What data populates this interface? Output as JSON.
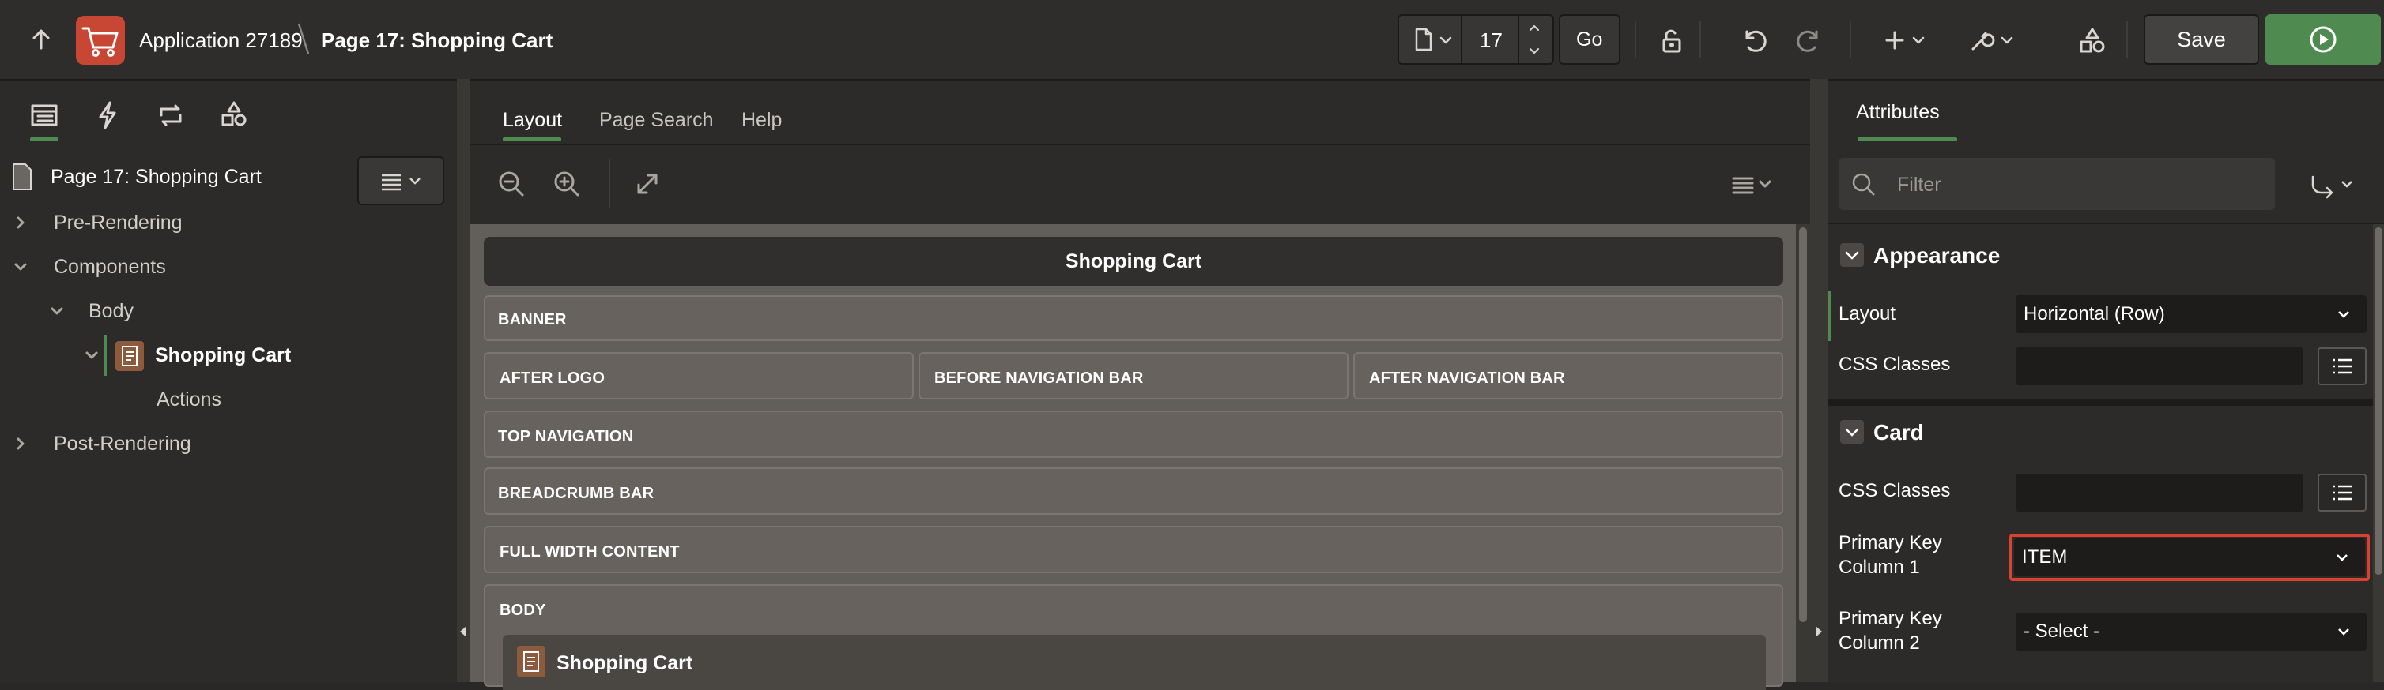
{
  "topbar": {
    "app_name": "Application 27189",
    "separator": "\\",
    "page_title": "Page 17: Shopping Cart",
    "page_number": "17",
    "go_label": "Go",
    "save_label": "Save",
    "colors": {
      "logo": "#c74634",
      "run": "#4f8b51"
    }
  },
  "left": {
    "root": "Page 17: Shopping Cart",
    "items": [
      {
        "label": "Pre-Rendering"
      },
      {
        "label": "Components"
      },
      {
        "label": "Body"
      },
      {
        "label": "Shopping Cart"
      },
      {
        "label": "Actions"
      },
      {
        "label": "Post-Rendering"
      }
    ]
  },
  "center": {
    "tabs": [
      "Layout",
      "Page Search",
      "Help"
    ],
    "page_header": "Shopping Cart",
    "regions": {
      "banner": "BANNER",
      "after_logo": "AFTER LOGO",
      "before_nav": "BEFORE NAVIGATION BAR",
      "after_nav": "AFTER NAVIGATION BAR",
      "top_nav": "TOP NAVIGATION",
      "breadcrumb": "BREADCRUMB BAR",
      "full_width": "FULL WIDTH CONTENT",
      "body": "BODY"
    },
    "body_region_title": "Shopping Cart"
  },
  "right": {
    "tab": "Attributes",
    "filter_placeholder": "Filter",
    "sections": {
      "appearance": {
        "title": "Appearance",
        "layout_label": "Layout",
        "layout_value": "Horizontal (Row)",
        "css_label": "CSS Classes"
      },
      "card": {
        "title": "Card",
        "css_label": "CSS Classes",
        "pk1_label": "Primary Key Column 1",
        "pk1_value": "ITEM",
        "pk2_label": "Primary Key Column 2",
        "pk2_value": "- Select -"
      }
    }
  }
}
